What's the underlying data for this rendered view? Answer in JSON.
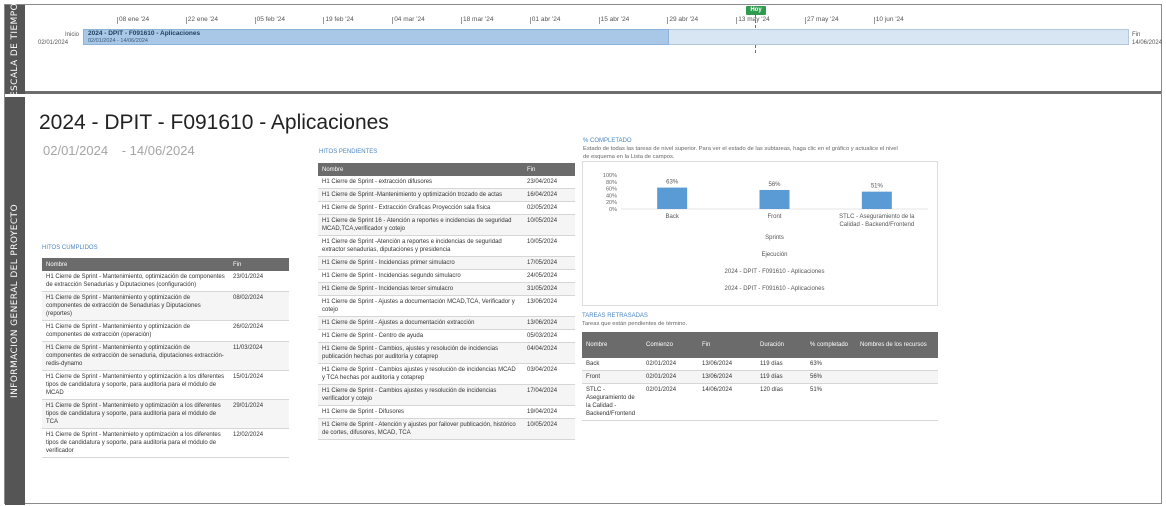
{
  "sidebar": {
    "timeline_label": "ESCALA DE TIEMPO",
    "info_label": "INFORMACION GENERAL DEL PROYECTO"
  },
  "timeline": {
    "today_label": "Hoy",
    "start_label": "Inicio",
    "start_date": "02/01/2024",
    "end_label": "Fin",
    "end_date": "14/06/2024",
    "bar_title": "2024 - DPIT - F091610 - Aplicaciones",
    "bar_dates": "02/01/2024 - 14/06/2024",
    "progress_fraction": 0.56,
    "ticks": [
      "08 ene '24",
      "22 ene '24",
      "05 feb '24",
      "19 feb '24",
      "04 mar '24",
      "18 mar '24",
      "01 abr '24",
      "15 abr '24",
      "29 abr '24",
      "13 may '24",
      "27 may '24",
      "10 jun '24"
    ]
  },
  "project": {
    "title": "2024 - DPIT - F091610 - Aplicaciones",
    "start": "02/01/2024",
    "end": "- 14/06/2024"
  },
  "hitos_cumplidos": {
    "title": "HITOS CUMPLIDOS",
    "headers": [
      "Nombre",
      "Fin"
    ],
    "rows": [
      [
        "H1 Cierre de Sprint - Mantenimiento, optimización de componentes de extracción Senadurias y Diputaciones (configuración)",
        "23/01/2024"
      ],
      [
        "H1 Cierre de Sprint - Mantenimiento y optimización de componentes de extracción de Senadurias y Diputaciones (reportes)",
        "08/02/2024"
      ],
      [
        "H1 Cierre de Sprint - Mantenimiento y optimización de componentes de extracción (operación)",
        "26/02/2024"
      ],
      [
        "H1 Cierre de Sprint - Mantenimiento y optimización de componentes de extracción de senaduria, diputaciones extracción-redis-dynamo",
        "11/03/2024"
      ],
      [
        "H1 Cierre de Sprint - Mantenimiento y optimización a los diferentes tipos de candidatura y soporte, para auditoria para el módulo de MCAD",
        "15/01/2024"
      ],
      [
        "H1 Cierre de Sprint - Mantenimieto y optimización a los diferentes tipos de candidatura y soporte, para auditoria para el módulo de TCA",
        "29/01/2024"
      ],
      [
        "H1 Cierre de Sprint - Mantenimieto y optimización a los diferentes tipos de candidatura y soporte, para auditoria para el módulo de verificador",
        "12/02/2024"
      ]
    ]
  },
  "hitos_pendientes": {
    "title": "HITOS PENDIENTES",
    "headers": [
      "Nombre",
      "Fin"
    ],
    "rows": [
      [
        "H1 Cierre de Sprint - extracción difusores",
        "23/04/2024"
      ],
      [
        "H1 Cierre de Sprint -Mantenimiento y optimización trozado de actas",
        "16/04/2024"
      ],
      [
        "H1 Cierre de Sprint - Extracción Graficas Proyección sala física",
        "02/05/2024"
      ],
      [
        "H1 Cierre de Sprint 16 - Atención a reportes e incidencias de seguridad MCAD,TCA,verificador y cotejo",
        "10/05/2024"
      ],
      [
        "H1 Cierre de Sprint -Atención a reportes e incidencias de seguridad extractor senadurias, diputaciones y presidencia",
        "10/05/2024"
      ],
      [
        "H1 Cierre de Sprint - Incidencias primer simulacro",
        "17/05/2024"
      ],
      [
        "H1 Cierre de Sprint - Incidencias segundo simulacro",
        "24/05/2024"
      ],
      [
        "H1 Cierre de Sprint - Incidencias tercer simulacro",
        "31/05/2024"
      ],
      [
        "H1 Cierre de Sprint - Ajustes a documentación MCAD,TCA, Verificador y cotejo",
        "13/06/2024"
      ],
      [
        "H1 Cierre de Sprint - Ajustes a documentación extracción",
        "13/06/2024"
      ],
      [
        "H1 Cierre de Sprint - Centro de ayuda",
        "05/03/2024"
      ],
      [
        "H1 Cierre de Sprint - Cambios, ajustes y resolución de incidencias publicación hechas por auditoría y cotaprep",
        "04/04/2024"
      ],
      [
        "H1 Cierre de Sprint - Cambios ajustes y resolución de incidencias MCAD y TCA hechas por auditoría y cotaprep",
        "03/04/2024"
      ],
      [
        "H1 Cierre de Sprint - Cambios ajustes y resolución de incidencias verificador y cotejo",
        "17/04/2024"
      ],
      [
        "H1 Cierre de Sprint - Difusores",
        "19/04/2024"
      ],
      [
        "H1 Cierre de Sprint - Atención y ajustes por failover publicación, histórico de cortes, difusores, MCAD, TCA",
        "10/05/2024"
      ]
    ]
  },
  "completion": {
    "title": "% COMPLETADO",
    "description": "Estado de todas las tareas de nivel superior. Para ver el estado de las subtareas, haga clic en el gráfico y actualice el nivel de esquema en la Lista de campos."
  },
  "chart_data": {
    "type": "bar",
    "categories": [
      "Back",
      "Front",
      "STLC - Aseguramiento de la Calidad - Backend/Frontend"
    ],
    "values": [
      63,
      56,
      51
    ],
    "data_labels": [
      "63%",
      "56%",
      "51%"
    ],
    "y_ticks": [
      "100%",
      "80%",
      "60%",
      "40%",
      "20%",
      "0%"
    ],
    "ylim": [
      0,
      100
    ],
    "xlabel_lines": [
      "Sprints",
      "Ejecución",
      "2024 - DPIT - F091610 - Aplicaciones",
      "2024 - DPIT - F091610 - Aplicaciones"
    ],
    "bar_color": "#5b9bd5",
    "grid": false
  },
  "tareas_retrasadas": {
    "title": "TAREAS RETRASADAS",
    "description": "Tareas que están pendientes de término.",
    "headers": [
      "Nombre",
      "Comienzo",
      "Fin",
      "Duración",
      "% completado",
      "Nombres de los recursos"
    ],
    "rows": [
      [
        "Back",
        "02/01/2024",
        "13/06/2024",
        "119 días",
        "63%",
        ""
      ],
      [
        "Front",
        "02/01/2024",
        "13/06/2024",
        "119 días",
        "56%",
        ""
      ],
      [
        "STLC - Aseguramiento de la Calidad - Backend/Frontend",
        "02/01/2024",
        "14/06/2024",
        "120 días",
        "51%",
        ""
      ]
    ]
  },
  "colors": {
    "accent": "#4a86c2",
    "header_bg": "#6b6b6b",
    "sidebar_bg": "#555555",
    "today": "#2e9b4e"
  }
}
